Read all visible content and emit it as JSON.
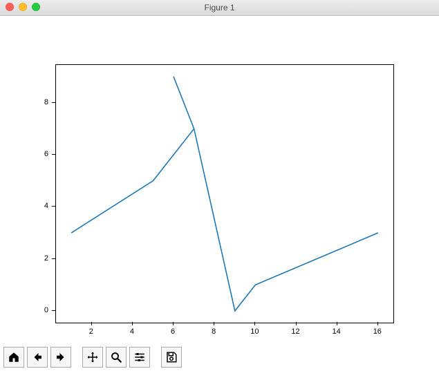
{
  "window": {
    "title": "Figure 1"
  },
  "toolbar": {
    "home": "Home",
    "back": "Back",
    "forward": "Forward",
    "pan": "Pan",
    "zoom": "Zoom",
    "configure": "Configure subplots",
    "save": "Save"
  },
  "chart_data": {
    "type": "line",
    "x": [
      1,
      5,
      7,
      6,
      7,
      9,
      10,
      16
    ],
    "y": [
      3,
      5,
      7,
      9,
      7,
      0,
      1,
      3
    ],
    "xlim": [
      0.25,
      16.75
    ],
    "ylim": [
      -0.45,
      9.45
    ],
    "xticks": [
      2,
      4,
      6,
      8,
      10,
      12,
      14,
      16
    ],
    "yticks": [
      0,
      2,
      4,
      6,
      8
    ],
    "line_color": "#1f77b4",
    "title": "",
    "xlabel": "",
    "ylabel": ""
  }
}
